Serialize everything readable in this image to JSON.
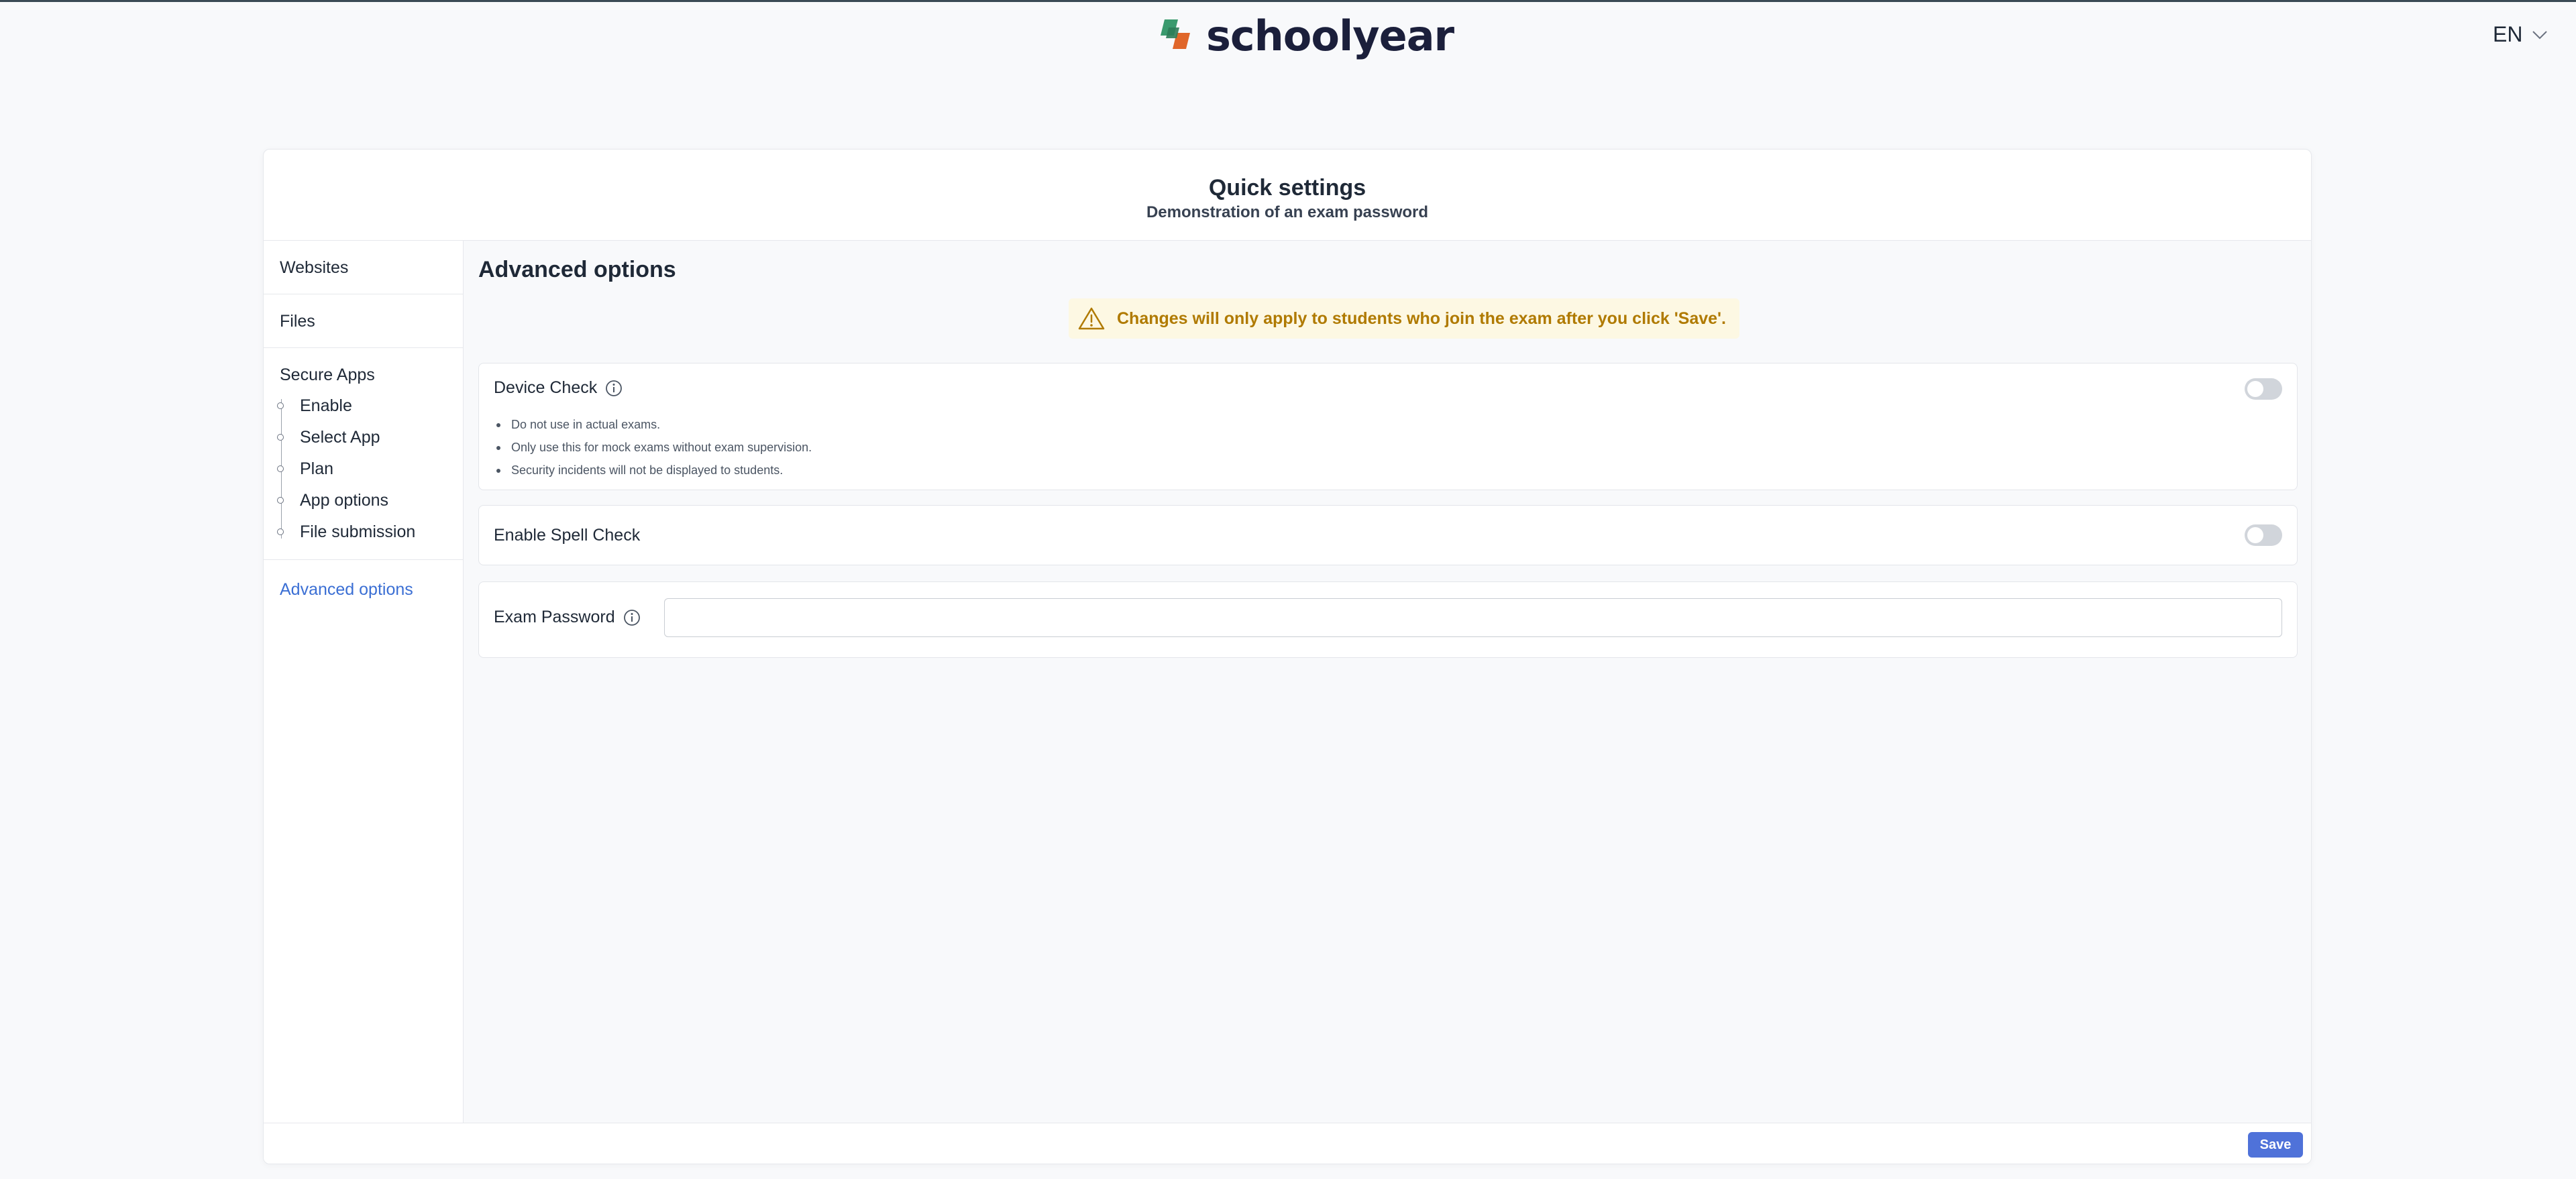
{
  "header": {
    "logo_text": "schoolyear",
    "language": "EN",
    "colors": {
      "logo_green": "#3a9a6e",
      "logo_orange": "#e0662a",
      "logo_text": "#1b1f3b"
    }
  },
  "card": {
    "title": "Quick settings",
    "subtitle": "Demonstration of an exam password"
  },
  "sidebar": {
    "items": [
      {
        "label": "Websites"
      },
      {
        "label": "Files"
      }
    ],
    "group": {
      "title": "Secure Apps",
      "subitems": [
        "Enable",
        "Select App",
        "Plan",
        "App options",
        "File submission"
      ]
    },
    "active": "Advanced options",
    "active_color": "#3b6fd4"
  },
  "main": {
    "title": "Advanced options",
    "notice": "Changes will only apply to students who join the exam after you click 'Save'.",
    "notice_color": "#b07a00",
    "device_check": {
      "label": "Device Check",
      "enabled": false,
      "bullets": [
        "Do not use in actual exams.",
        "Only use this for mock exams without exam supervision.",
        "Security incidents will not be displayed to students."
      ]
    },
    "spell_check": {
      "label": "Enable Spell Check",
      "enabled": false
    },
    "exam_password": {
      "label": "Exam Password",
      "value": "",
      "placeholder": ""
    }
  },
  "footer": {
    "save_label": "Save",
    "save_color": "#4f72d9"
  }
}
